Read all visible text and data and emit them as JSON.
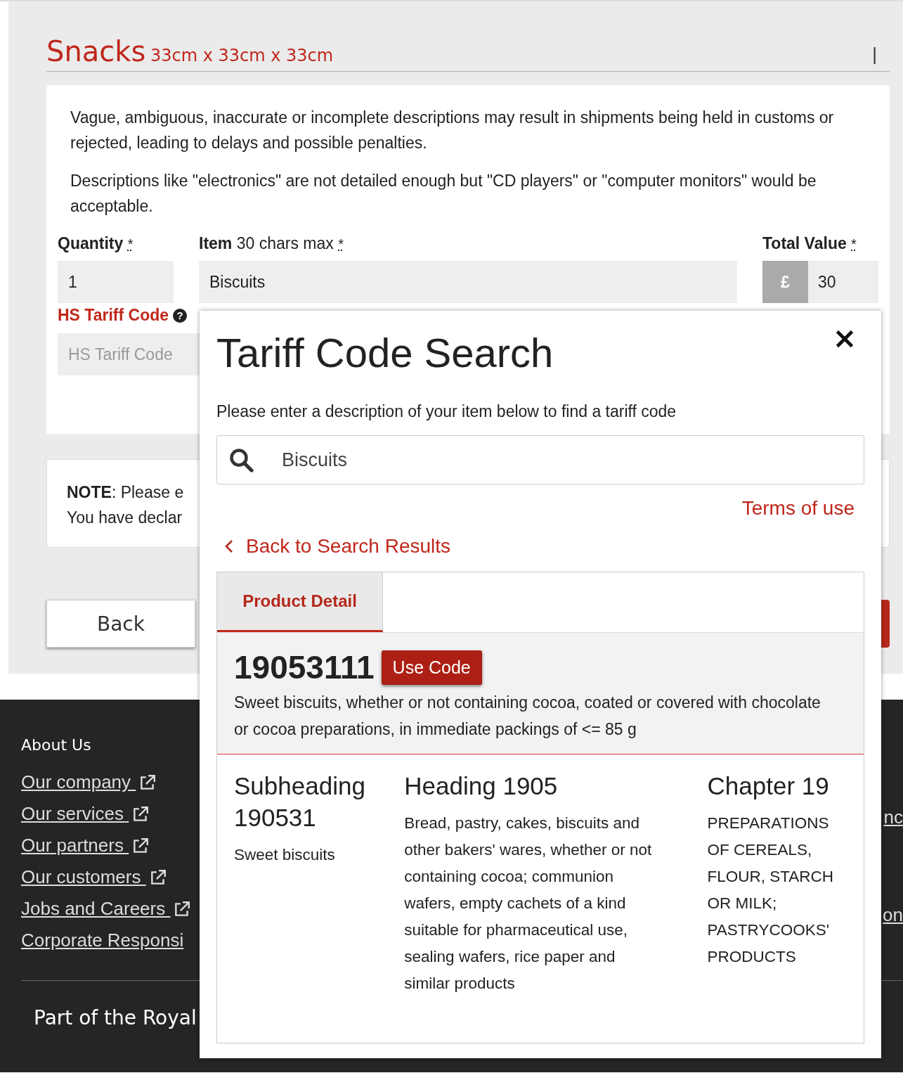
{
  "section": {
    "title": "Snacks",
    "dimensions": "33cm x 33cm x 33cm",
    "divider": "|"
  },
  "warnings": [
    "Vague, ambiguous, inaccurate or incomplete descriptions may result in shipments being held in customs or rejected, leading to delays and possible penalties.",
    "Descriptions like \"electronics\" are not detailed enough but \"CD players\" or \"computer monitors\" would be acceptable."
  ],
  "fields": [
    {
      "kind": "plain",
      "label": "**Quantity**",
      "required_mark": "*",
      "value": "1"
    },
    {
      "kind": "plain",
      "label": "**Item** 30 chars max",
      "required_mark": "*",
      "value": "Biscuits"
    },
    {
      "kind": "currency",
      "label": "**Total Value**",
      "required_mark": "*",
      "prefix": "£",
      "value": "30"
    }
  ],
  "hs_tariff": {
    "label": "HS Tariff Code",
    "help": "?",
    "placeholder": "HS Tariff Code"
  },
  "note": {
    "lines": [
      "**NOTE**: Please e",
      "You have declar"
    ]
  },
  "back_button": "Back",
  "footer": {
    "heading": "About Us",
    "links": [
      {
        "label": "Our company ",
        "external": true
      },
      {
        "label": "Our services ",
        "external": true
      },
      {
        "label": "Our partners ",
        "external": true
      },
      {
        "label": "Our customers ",
        "external": true
      },
      {
        "label": "Jobs and Careers ",
        "external": true
      },
      {
        "label": "Corporate Responsi",
        "external": false
      }
    ],
    "column_2_fragments": [
      "nc",
      "on"
    ],
    "group_text": "Part of the Royal"
  },
  "modal": {
    "title": "Tariff Code Search",
    "description": "Please enter a description of your item below to find a tariff code",
    "search": {
      "value": "Biscuits"
    },
    "terms_link": "Terms of use",
    "back_link": "Back to Search Results",
    "tabs": [
      {
        "label": "Product Detail",
        "selected": true
      }
    ],
    "product": {
      "code": "19053111",
      "button": "Use Code",
      "description": "Sweet biscuits, whether or not containing cocoa, coated or covered with chocolate or cocoa preparations, in immediate packings of <= 85 g"
    },
    "levels": [
      {
        "title": "Subheading 190531",
        "body": "Sweet biscuits"
      },
      {
        "title": "Heading 1905",
        "body": "Bread, pastry, cakes, biscuits and other bakers' wares, whether or not containing cocoa; communion wafers, empty cachets of a kind suitable for pharmaceutical use, sealing wafers, rice paper and similar products"
      },
      {
        "title": "Chapter 19",
        "body": "PREPARATIONS OF CEREALS, FLOUR, STARCH OR MILK; PASTRYCOOKS' PRODUCTS"
      }
    ]
  }
}
